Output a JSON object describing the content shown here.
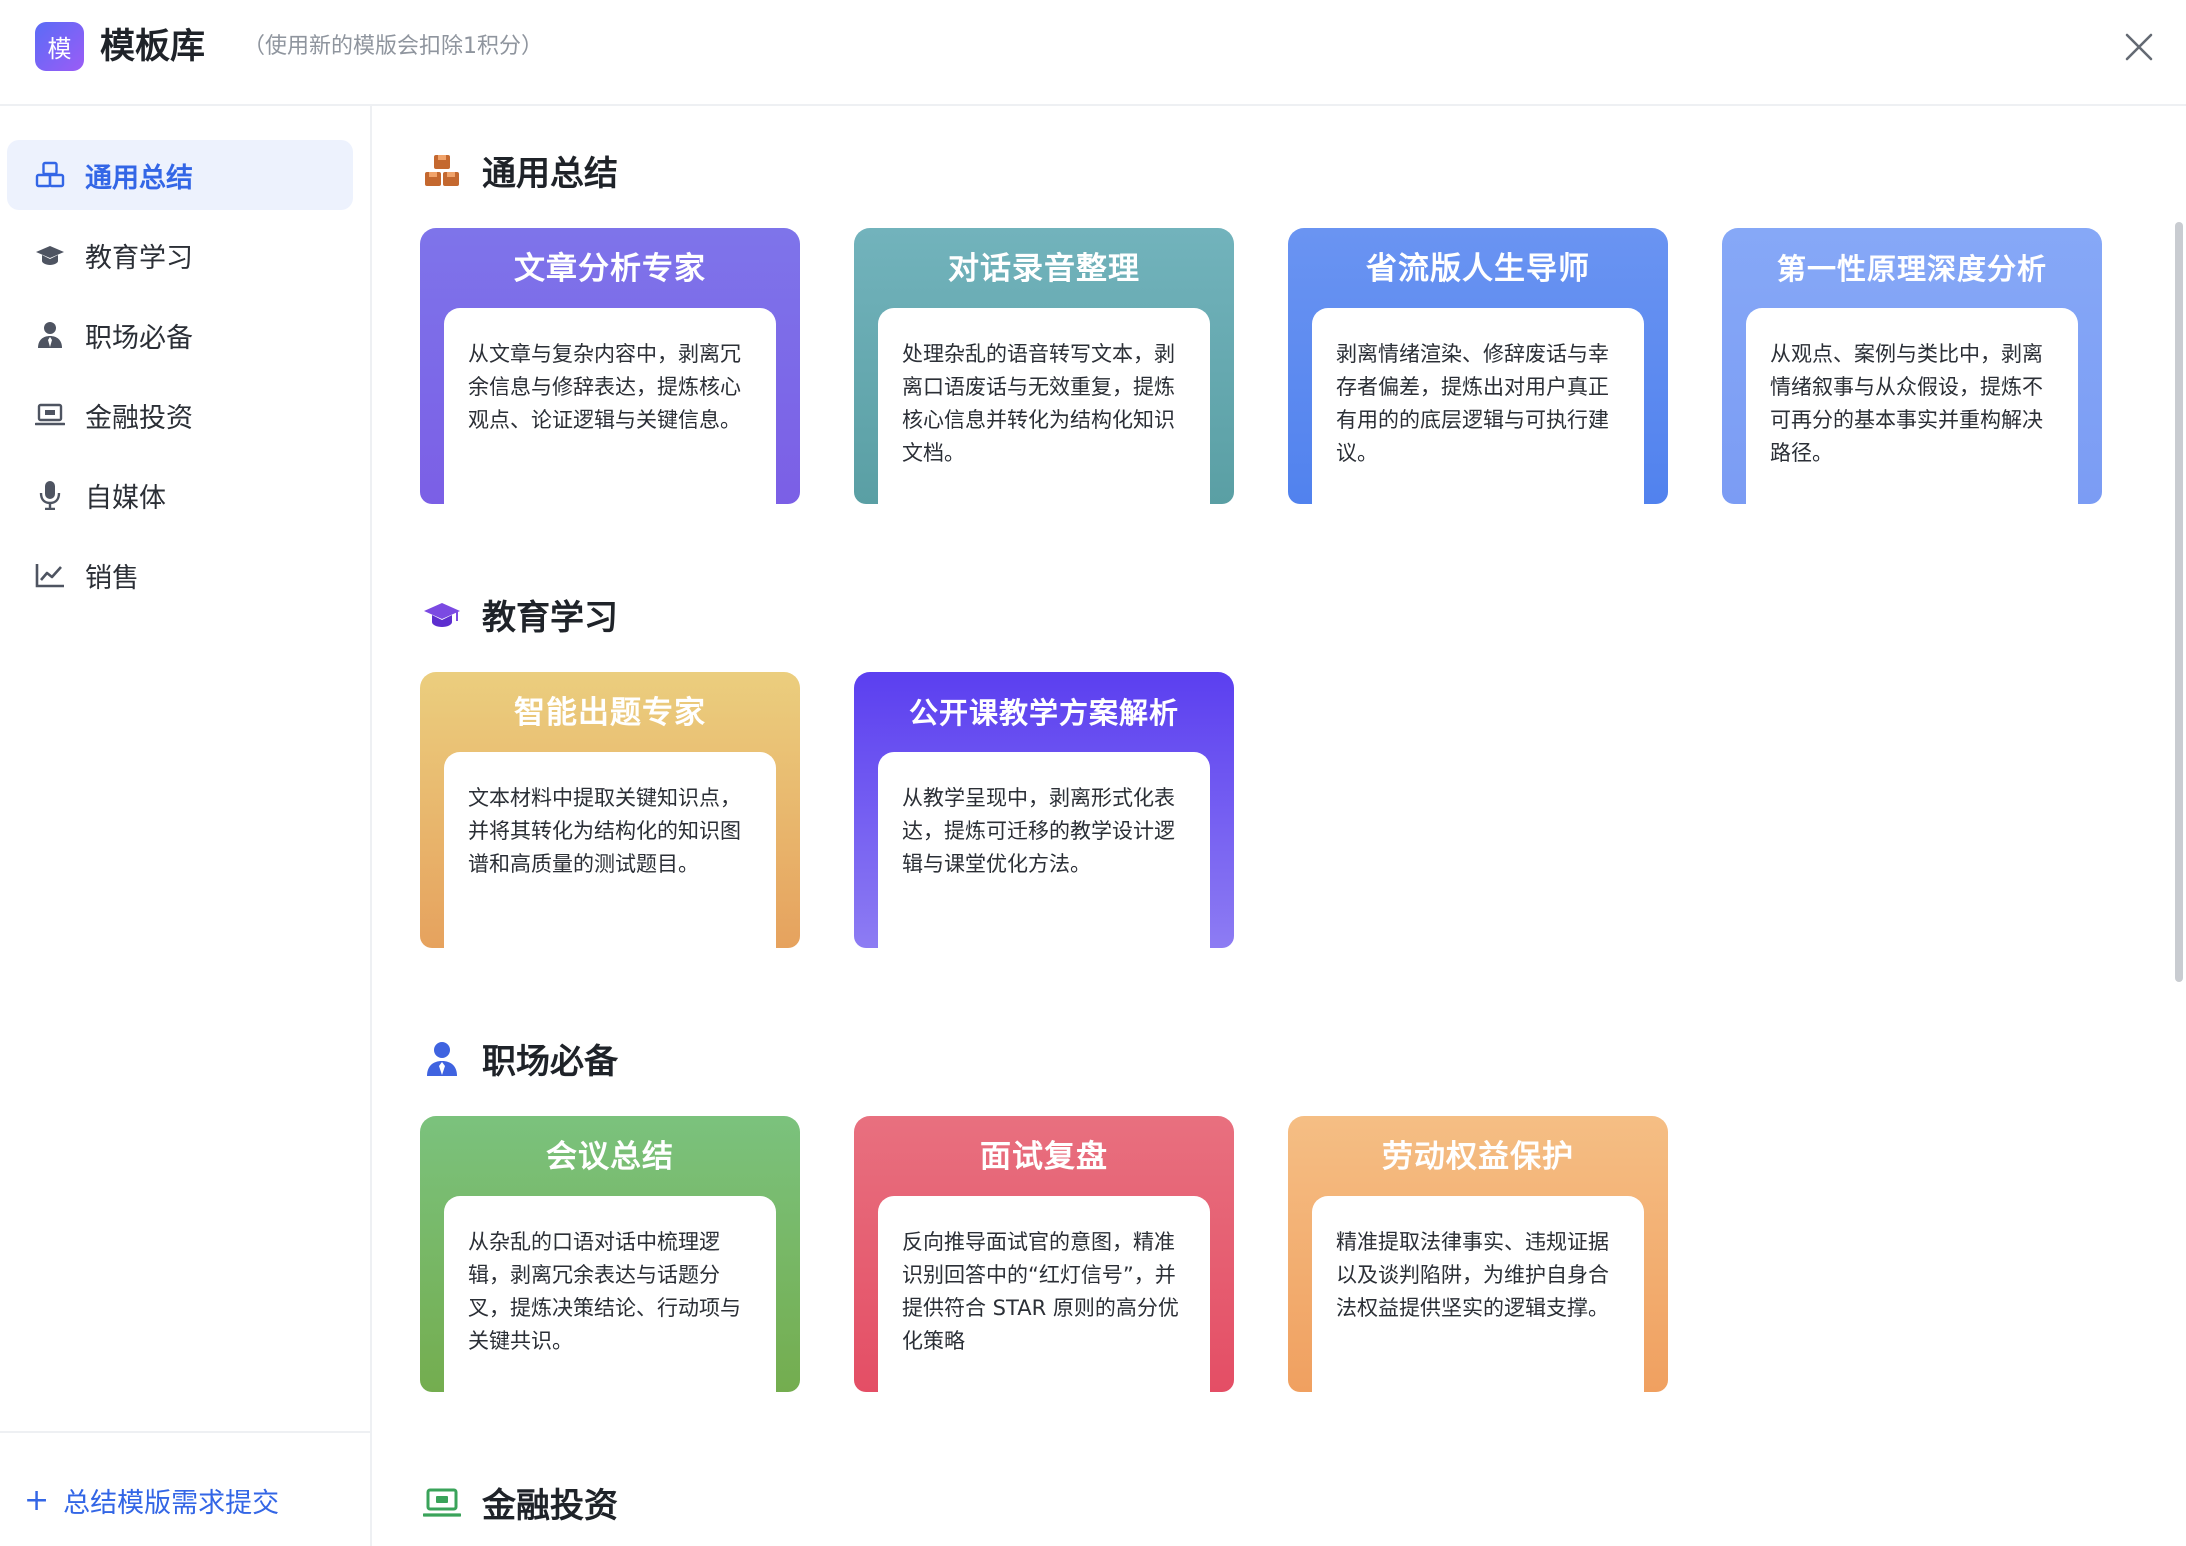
{
  "header": {
    "logo_char": "模",
    "title": "模板库",
    "subtitle": "（使用新的模版会扣除1积分）"
  },
  "sidebar": {
    "items": [
      {
        "label": "通用总结",
        "icon": "boxes-icon",
        "active": true
      },
      {
        "label": "教育学习",
        "icon": "graduation-cap-icon"
      },
      {
        "label": "职场必备",
        "icon": "user-tie-icon"
      },
      {
        "label": "金融投资",
        "icon": "laptop-icon"
      },
      {
        "label": "自媒体",
        "icon": "microphone-icon"
      },
      {
        "label": "销售",
        "icon": "chart-line-icon"
      }
    ],
    "footer_label": "总结模版需求提交"
  },
  "sections": [
    {
      "title": "通用总结",
      "icon": "boxes-icon",
      "icon_color": "#c4682f",
      "cards": [
        {
          "title": "文章分析专家",
          "desc": "从文章与复杂内容中，剥离冗余信息与修辞表达，提炼核心观点、论证逻辑与关键信息。"
        },
        {
          "title": "对话录音整理",
          "desc": "处理杂乱的语音转写文本，剥离口语废话与无效重复，提炼核心信息并转化为结构化知识文档。"
        },
        {
          "title": "省流版人生导师",
          "desc": "剥离情绪渲染、修辞废话与幸存者偏差，提炼出对用户真正有用的的底层逻辑与可执行建议。"
        },
        {
          "title": "第一性原理深度分析",
          "desc": "从观点、案例与类比中，剥离情绪叙事与从众假设，提炼不可再分的基本事实并重构解决路径。"
        }
      ]
    },
    {
      "title": "教育学习",
      "icon": "graduation-cap-icon",
      "icon_color": "#7b4ae2",
      "cards": [
        {
          "title": "智能出题专家",
          "desc": "文本材料中提取关键知识点，并将其转化为结构化的知识图谱和高质量的测试题目。"
        },
        {
          "title": "公开课教学方案解析",
          "desc": "从教学呈现中，剥离形式化表达，提炼可迁移的教学设计逻辑与课堂优化方法。"
        }
      ]
    },
    {
      "title": "职场必备",
      "icon": "user-tie-icon",
      "icon_color": "#3f63e0",
      "cards": [
        {
          "title": "会议总结",
          "desc": "从杂乱的口语对话中梳理逻辑，剥离冗余表达与话题分叉，提炼决策结论、行动项与关键共识。"
        },
        {
          "title": "面试复盘",
          "desc": "反向推导面试官的意图，精准识别回答中的“红灯信号”，并提供符合 STAR 原则的高分优化策略"
        },
        {
          "title": "劳动权益保护",
          "desc": "精准提取法律事实、违规证据以及谈判陷阱，为维护自身合法权益提供坚实的逻辑支撑。"
        }
      ]
    },
    {
      "title": "金融投资",
      "icon": "laptop-icon",
      "icon_color": "#3aa35a",
      "cards": []
    }
  ]
}
